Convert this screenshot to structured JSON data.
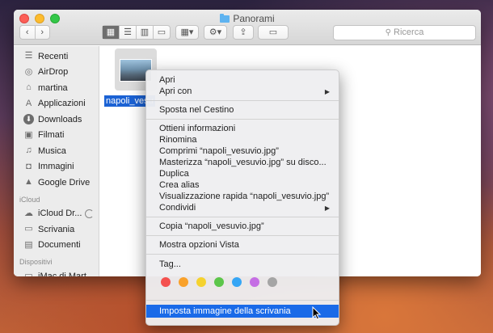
{
  "window": {
    "title": "Panorami",
    "search_placeholder": "Ricerca"
  },
  "sidebar": {
    "items": [
      {
        "label": "Recenti",
        "icon": "recents-icon"
      },
      {
        "label": "AirDrop",
        "icon": "airdrop-icon"
      },
      {
        "label": "martina",
        "icon": "home-icon"
      },
      {
        "label": "Applicazioni",
        "icon": "applications-icon"
      },
      {
        "label": "Downloads",
        "icon": "downloads-icon"
      },
      {
        "label": "Filmati",
        "icon": "movies-icon"
      },
      {
        "label": "Musica",
        "icon": "music-icon"
      },
      {
        "label": "Immagini",
        "icon": "pictures-icon"
      },
      {
        "label": "Google Drive",
        "icon": "google-drive-icon"
      }
    ],
    "icloud_header": "iCloud",
    "icloud_items": [
      {
        "label": "iCloud Dr...",
        "icon": "icloud-icon"
      },
      {
        "label": "Scrivania",
        "icon": "desktop-icon"
      },
      {
        "label": "Documenti",
        "icon": "documents-icon"
      }
    ],
    "devices_header": "Dispositivi",
    "devices_items": [
      {
        "label": "iMac di Mart",
        "icon": "imac-icon"
      }
    ]
  },
  "file": {
    "name": "napoli_vesuvio.jpg",
    "label": "napoli_vesu"
  },
  "context_menu": {
    "items": [
      "Apri",
      "Apri con",
      "Sposta nel Cestino",
      "Ottieni informazioni",
      "Rinomina",
      "Comprimi “napoli_vesuvio.jpg”",
      "Masterizza “napoli_vesuvio.jpg” su disco...",
      "Duplica",
      "Crea alias",
      "Visualizzazione rapida “napoli_vesuvio.jpg”",
      "Condividi",
      "Copia “napoli_vesuvio.jpg”",
      "Mostra opzioni Vista",
      "Tag...",
      "Imposta immagine della scrivania"
    ],
    "tag_colors": [
      "#f4504e",
      "#f9a12a",
      "#f5d22e",
      "#5cc64a",
      "#36a6f5",
      "#c56ee4",
      "#a5a5a5"
    ]
  },
  "colors": {
    "selection": "#1a6ae8",
    "file_label_bg": "#1b62d4"
  }
}
